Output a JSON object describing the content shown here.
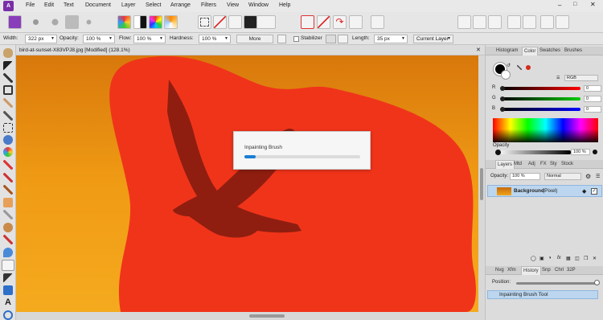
{
  "menu": [
    "File",
    "Edit",
    "Text",
    "Document",
    "Layer",
    "Select",
    "Arrange",
    "Filters",
    "View",
    "Window",
    "Help"
  ],
  "context_bar": {
    "width_label": "Width:",
    "width_value": "322 px",
    "opacity_label": "Opacity:",
    "opacity_value": "100 %",
    "flow_label": "Flow:",
    "flow_value": "100 %",
    "hardness_label": "Hardness:",
    "hardness_value": "100 %",
    "more_label": "More",
    "stabilizer_label": "Stabilizer",
    "length_label": "Length:",
    "length_value": "35 px",
    "layer_select": "Current Layer"
  },
  "document": {
    "title": "bird-at-sunset-X83VPJ8.jpg [Modified] (128.1%)"
  },
  "dialog": {
    "title": "Inpainting Brush",
    "progress": 0.1
  },
  "color_panel": {
    "tabs": [
      "Histogram",
      "Color",
      "Swatches",
      "Brushes"
    ],
    "active_tab": "Color",
    "mode": "RGB",
    "channels": [
      {
        "name": "R",
        "value": "0"
      },
      {
        "name": "G",
        "value": "0"
      },
      {
        "name": "B",
        "value": "0"
      }
    ],
    "opacity_label": "Opacity",
    "opacity_value": "100 %"
  },
  "layers_panel": {
    "tabs": [
      "Layers",
      "Mtd",
      "Adj",
      "FX",
      "Sty",
      "Stock"
    ],
    "active_tab": "Layers",
    "opacity_label": "Opacity:",
    "opacity_value": "100 %",
    "blend_mode": "Normal",
    "layers": [
      {
        "name": "Background",
        "type": "(Pixel)"
      }
    ]
  },
  "history_panel": {
    "tabs": [
      "Nvg",
      "Xfm",
      "History",
      "Snp",
      "Chrl",
      "32P"
    ],
    "active_tab": "History",
    "position_label": "Position:",
    "items": [
      "Inpainting Brush Tool"
    ]
  },
  "colors": {
    "accent": "#1a7fd4",
    "orange": "#e9930d",
    "mask": "#f0341a"
  }
}
